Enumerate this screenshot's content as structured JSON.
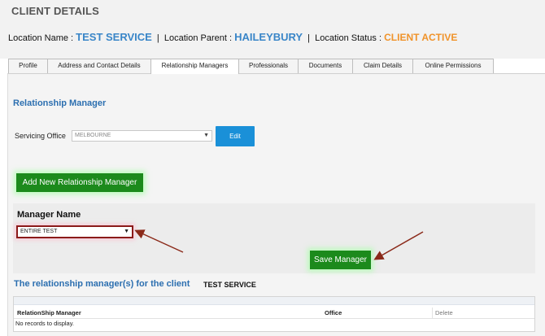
{
  "page_title": "CLIENT DETAILS",
  "location": {
    "name_label": "Location Name :",
    "name_value": "TEST SERVICE",
    "parent_label": "Location Parent :",
    "parent_value": "HAILEYBURY",
    "status_label": "Location Status :",
    "status_value": "CLIENT ACTIVE",
    "separator": "|"
  },
  "tabs": [
    {
      "label": "Profile"
    },
    {
      "label": "Address and Contact Details"
    },
    {
      "label": "Relationship Managers"
    },
    {
      "label": "Professionals"
    },
    {
      "label": "Documents"
    },
    {
      "label": "Claim Details"
    },
    {
      "label": "Online Permissions"
    }
  ],
  "active_tab": "Relationship Managers",
  "section": {
    "heading": "Relationship Manager",
    "servicing_office_label": "Servicing Office",
    "servicing_office_value": "MELBOURNE",
    "edit_label": "Edit",
    "add_label": "Add New Relationship Manager",
    "manager_name_label": "Manager Name",
    "manager_name_value": "ENTIRE TEST",
    "save_label": "Save Manager"
  },
  "list": {
    "heading": "The relationship manager(s) for the client",
    "client_name": "TEST SERVICE",
    "columns": [
      "RelationShip Manager",
      "Office",
      "Delete"
    ],
    "empty_text": "No records to display."
  },
  "colors": {
    "accent_blue": "#3a86c8",
    "status_orange": "#f0932a",
    "button_green": "#1c8a1c",
    "edit_blue": "#1a90d8",
    "annotation_arrow": "#8b2a1a"
  },
  "icons": {
    "dropdown_caret": "caret-down-icon",
    "annotation": "arrow-annotation-icon"
  }
}
